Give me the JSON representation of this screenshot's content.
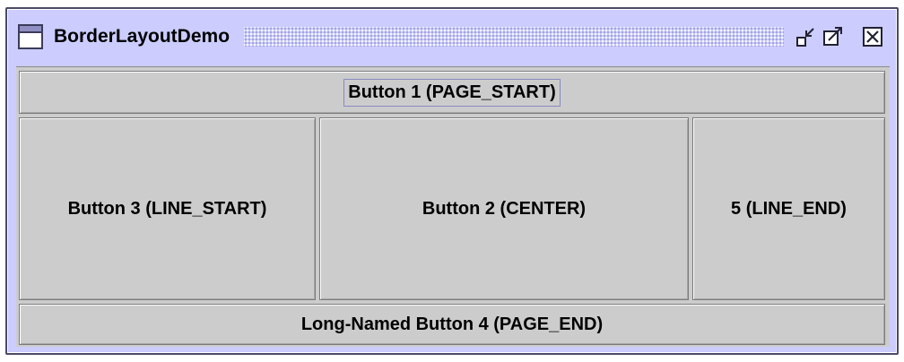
{
  "window": {
    "title": "BorderLayoutDemo",
    "controls": {
      "iconify": "iconify-icon",
      "maximize": "maximize-icon",
      "close": "close-icon"
    }
  },
  "buttons": {
    "page_start": "Button 1 (PAGE_START)",
    "line_start": "Button 3 (LINE_START)",
    "center": "Button 2 (CENTER)",
    "line_end": "5 (LINE_END)",
    "page_end": "Long-Named Button 4 (PAGE_END)"
  },
  "colors": {
    "frame": "#ccccff",
    "content": "#cccccc",
    "focus": "#8a8ac4"
  }
}
